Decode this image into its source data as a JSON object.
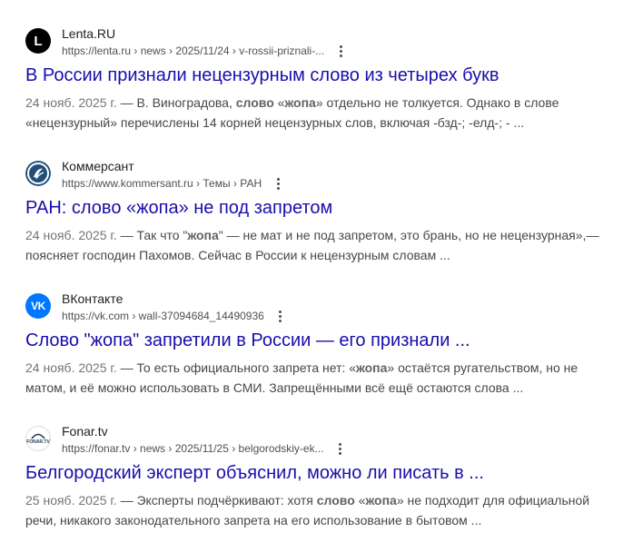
{
  "results": [
    {
      "site": "Lenta.RU",
      "url": "https://lenta.ru › news › 2025/11/24 › v-rossii-priznali-...",
      "title": "В России признали нецензурным слово из четырех букв",
      "date": "24 нояб. 2025 г.",
      "snippet_before": " — В. Виноградова, ",
      "snippet_bold1": "слово",
      "snippet_mid1": " «",
      "snippet_bold2": "жопа",
      "snippet_after": "» отдельно не толкуется. Однако в слове «нецензурный» перечислены 14 корней нецензурных слов, включая -бзд-; -елд-; - ...",
      "icon": "lenta-logo-icon",
      "icon_color": "#000000"
    },
    {
      "site": "Коммерсант",
      "url": "https://www.kommersant.ru › Темы › РАН",
      "title": "РАН: слово «жопа» не под запретом",
      "date": "24 нояб. 2025 г.",
      "snippet_before": " — Так что \"",
      "snippet_bold1": "жопа",
      "snippet_mid1": "\" — не мат и не под запретом, это брань, но не нецензурная»,— поясняет господин Пахомов. Сейчас в России к нецензурным словам ...",
      "snippet_bold2": "",
      "snippet_after": "",
      "icon": "kommersant-logo-icon",
      "icon_color": "#1f4f7a"
    },
    {
      "site": "ВКонтакте",
      "url": "https://vk.com › wall-37094684_14490936",
      "title": "Слово \"жопа\" запретили в России — его признали ...",
      "date": "24 нояб. 2025 г.",
      "snippet_before": " — То есть официального запрета нет: «",
      "snippet_bold1": "жопа",
      "snippet_mid1": "» остаётся ругательством, но не матом, и её можно использовать в СМИ. Запрещёнными всё ещё остаются слова ...",
      "snippet_bold2": "",
      "snippet_after": "",
      "icon": "vk-logo-icon",
      "icon_color": "#0077ff"
    },
    {
      "site": "Fonar.tv",
      "url": "https://fonar.tv › news › 2025/11/25 › belgorodskiy-ek...",
      "title": "Белгородский эксперт объяснил, можно ли писать в ...",
      "date": "25 нояб. 2025 г.",
      "snippet_before": " — Эксперты подчёркивают: хотя ",
      "snippet_bold1": "слово",
      "snippet_mid1": " «",
      "snippet_bold2": "жопа",
      "snippet_after": "» не подходит для официальной речи, никакого законодательного запрета на его использование в бытовом ...",
      "icon": "fonar-logo-icon",
      "icon_color": "#1d3b5c",
      "icon_text": "FONAR.TV"
    }
  ],
  "icons": {
    "lenta_letter": "L",
    "vk_letter": "VK"
  }
}
